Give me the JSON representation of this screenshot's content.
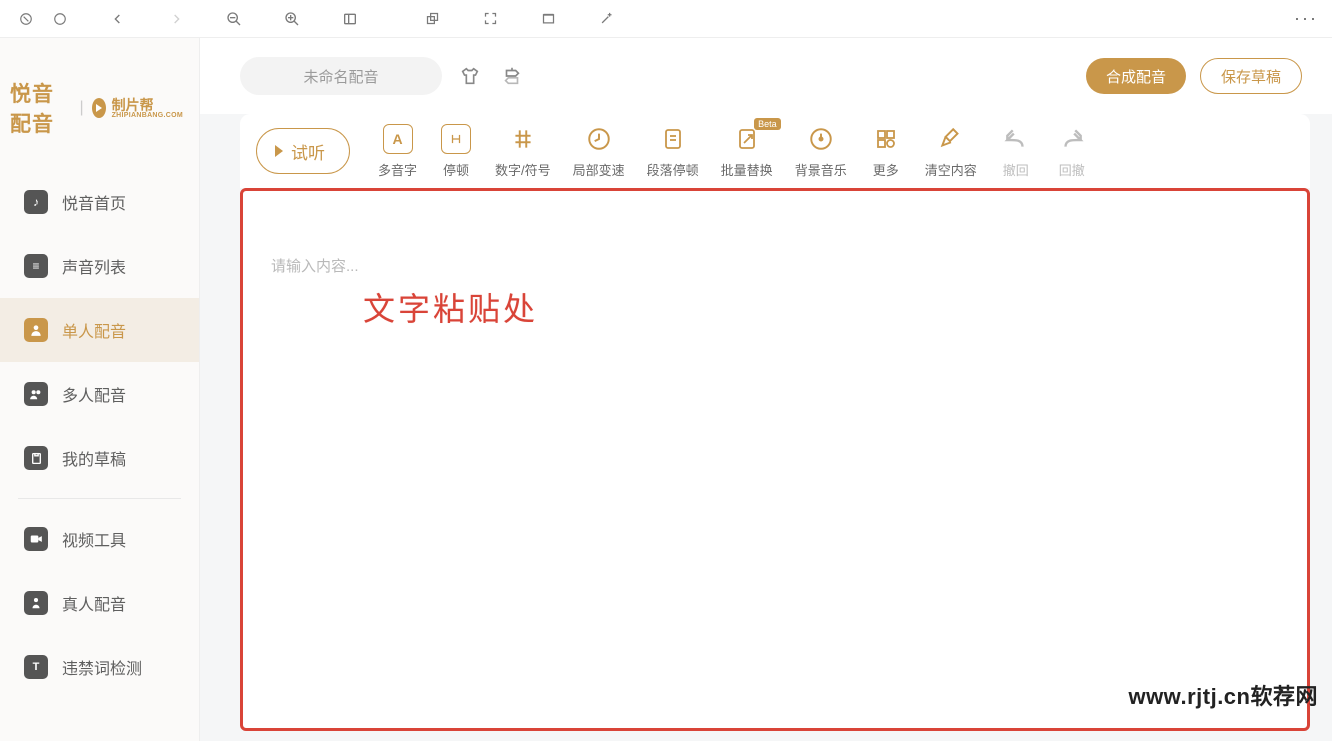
{
  "topbar": {
    "more": "···"
  },
  "logo": {
    "main": "悦音配音",
    "sub": "制片帮",
    "sub_en": "ZHIPIANBANG.COM"
  },
  "sidebar": {
    "items": [
      {
        "label": "悦音首页",
        "icon": "note-icon"
      },
      {
        "label": "声音列表",
        "icon": "list-icon"
      },
      {
        "label": "单人配音",
        "icon": "person-icon",
        "active": true
      },
      {
        "label": "多人配音",
        "icon": "group-icon"
      },
      {
        "label": "我的草稿",
        "icon": "draft-icon"
      },
      {
        "label": "视频工具",
        "icon": "video-icon"
      },
      {
        "label": "真人配音",
        "icon": "mic-icon"
      },
      {
        "label": "违禁词检测",
        "icon": "shield-icon"
      }
    ]
  },
  "header": {
    "title": "未命名配音",
    "synthesize": "合成配音",
    "save_draft": "保存草稿"
  },
  "tools": {
    "try": "试听",
    "items": [
      {
        "label": "多音字",
        "name": "polyphone"
      },
      {
        "label": "停顿",
        "name": "pause"
      },
      {
        "label": "数字/符号",
        "name": "number-symbol"
      },
      {
        "label": "局部变速",
        "name": "speed"
      },
      {
        "label": "段落停顿",
        "name": "paragraph-pause"
      },
      {
        "label": "批量替换",
        "name": "batch-replace",
        "badge": "Beta"
      },
      {
        "label": "背景音乐",
        "name": "bgm"
      },
      {
        "label": "更多",
        "name": "more-tools"
      },
      {
        "label": "清空内容",
        "name": "clear"
      },
      {
        "label": "撤回",
        "name": "undo",
        "gray": true
      },
      {
        "label": "回撤",
        "name": "redo",
        "gray": true
      }
    ]
  },
  "editor": {
    "placeholder": "请输入内容...",
    "paste_hint": "文字粘贴处"
  },
  "watermark": "www.rjtj.cn软荐网"
}
